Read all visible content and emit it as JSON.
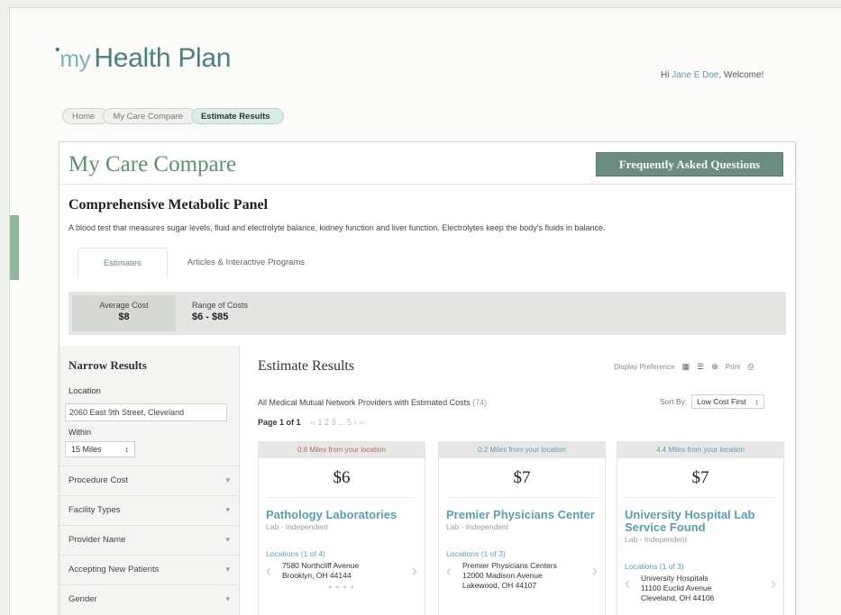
{
  "header": {
    "logo_dot": "•",
    "logo_my": "my",
    "logo_rest": "Health Plan",
    "welcome_prefix": "Hi",
    "welcome_user": "Jane E Doe",
    "welcome_suffix": ", Welcome!"
  },
  "breadcrumb": [
    "Home",
    "My Care Compare",
    "Estimate Results"
  ],
  "panel": {
    "title": "My Care Compare",
    "faq_button": "Frequently Asked Questions"
  },
  "procedure": {
    "title": "Comprehensive Metabolic Panel",
    "description": "A blood test that measures sugar levels, fluid and electrolyte balance, kidney function and liver function. Electrolytes keep the body's fluids in balance."
  },
  "tabs": [
    "Estimates",
    "Articles & Interactive Programs"
  ],
  "costs": {
    "average_label": "Average Cost",
    "average_value": "$8",
    "range_label": "Range of Costs",
    "range_value": "$6 - $85"
  },
  "narrow": {
    "title": "Narrow Results",
    "location_label": "Location",
    "location_value": "2060 East 9th Street, Cleveland",
    "within_label": "Within",
    "within_value": "15 Miles",
    "within_arrow": "↕",
    "filters": [
      "Procedure Cost",
      "Facility Types",
      "Provider Name",
      "Accepting New Patients",
      "Gender"
    ],
    "filter_chevron": "▾"
  },
  "results": {
    "title": "Estimate Results",
    "display_label": "Display Preference",
    "display_icons": [
      "▦",
      "☰",
      "⊕",
      "Print",
      "⎙"
    ],
    "subtitle": "All Medical Mutual Network Providers with Estimated Costs",
    "count": "(74)",
    "sort_label": "Sort By:",
    "sort_value": "Low Cost First",
    "sort_arrow": "↕",
    "page_label": "Page 1 of 1",
    "page_nums": "‹‹ 1 2 3 ... 5 › ››"
  },
  "cards": [
    {
      "distance": "0.8 Miles from your location",
      "price": "$6",
      "name": "Pathology Laboratories",
      "type": "Lab - Independent",
      "locations": "Locations (1 of 4)",
      "address": [
        "7580 Northcliff Avenue",
        "Brooklyn, OH 44144"
      ],
      "arrows": [
        "‹",
        "›"
      ],
      "dots": "● ● ● ●"
    },
    {
      "distance": "0.2 Miles from your location",
      "price": "$7",
      "name": "Premier Physicians Center",
      "type": "Lab - Independent",
      "locations": "Locations (1 of 3)",
      "address": [
        "Premier Physicians Centers",
        "12000 Madison Avenue",
        "Lakewood, OH 44107"
      ],
      "arrows": [
        "‹",
        "›"
      ]
    },
    {
      "distance": "4.4 Miles from your location",
      "price": "$7",
      "name": "University Hospital Lab Service Found",
      "type": "Lab - Independent",
      "locations": "Locations (1 of 3)",
      "address": [
        "University Hospitals",
        "11100 Euclid Avenue",
        "Cleveland, OH 44106"
      ],
      "arrows": [
        "‹",
        "›"
      ]
    }
  ]
}
